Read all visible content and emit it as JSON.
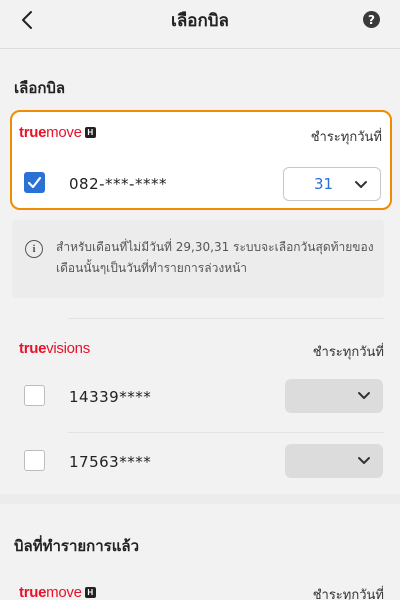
{
  "header": {
    "title": "เลือกบิล",
    "back_icon": "chevron-left-icon",
    "help_label": "?"
  },
  "select_bill": {
    "section_title": "เลือกบิล",
    "truemove_account": {
      "logo": {
        "brand": "true",
        "product": "move",
        "badge": "H"
      },
      "pay_label": "ชำระทุกวันที่",
      "number": "082-***-****",
      "checked": true,
      "selected_day": "31"
    },
    "info_note": "สำหรับเดือนที่ไม่มีวันที่ 29,30,31 ระบบจะเลือกวันสุดท้ายของเดือนนั้นๆเป็นวันที่ทำรายการล่วงหน้า",
    "truevisions": {
      "logo": {
        "brand": "true",
        "product": "visions"
      },
      "pay_label": "ชำระทุกวันที่",
      "accounts": [
        {
          "number": "14339****",
          "checked": false
        },
        {
          "number": "17563****",
          "checked": false
        }
      ]
    }
  },
  "completed_bills": {
    "section_title": "บิลที่ทำรายการแล้ว",
    "logo": {
      "brand": "true",
      "product": "move",
      "badge": "H"
    },
    "pay_label": "ชำระทุกวันที่"
  },
  "colors": {
    "accent_blue": "#2a71d6",
    "highlight_orange": "#f08c00",
    "brand_red": "#e6132b"
  }
}
